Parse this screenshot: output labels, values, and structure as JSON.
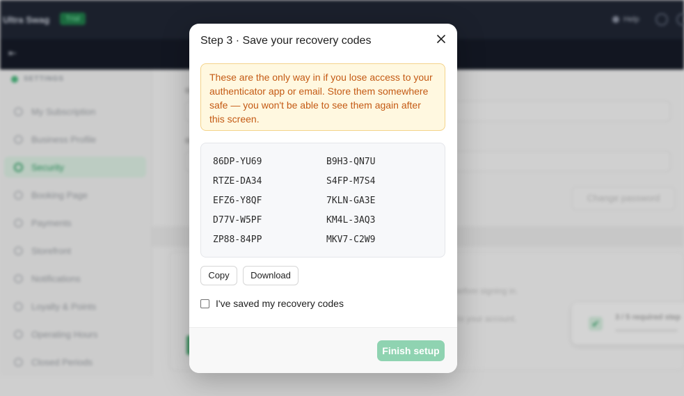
{
  "app": {
    "name": "Ultra Swag",
    "badge": "Trial",
    "help_label": "Help"
  },
  "sidebar": {
    "section_label": "SETTINGS",
    "items": [
      {
        "label": "My Subscription"
      },
      {
        "label": "Business Profile"
      },
      {
        "label": "Security",
        "active": true
      },
      {
        "label": "Booking Page"
      },
      {
        "label": "Payments"
      },
      {
        "label": "Storefront"
      },
      {
        "label": "Notifications"
      },
      {
        "label": "Loyalty & Points"
      },
      {
        "label": "Operating Hours"
      },
      {
        "label": "Closed Periods"
      }
    ]
  },
  "security_page": {
    "change_password_label": "Change password",
    "lower_text_1": "before signing in.",
    "lower_text_2": "to your account.",
    "progress_card_text": "3 / 5 required step"
  },
  "modal": {
    "title": "Step 3 · Save your recovery codes",
    "warning": "These are the only way in if you lose access to your authenticator app or email. Store them somewhere safe — you won't be able to see them again after this screen.",
    "codes": [
      "86DP-YU69",
      "B9H3-QN7U",
      "RTZE-DA34",
      "S4FP-M7S4",
      "EFZ6-Y8QF",
      "7KLN-GA3E",
      "D77V-W5PF",
      "KM4L-3AQ3",
      "ZP88-84PP",
      "MKV7-C2W9"
    ],
    "copy_label": "Copy",
    "download_label": "Download",
    "confirm_label": "I've saved my recovery codes",
    "confirm_checked": false,
    "finish_label": "Finish setup",
    "finish_enabled": false
  },
  "colors": {
    "accent": "#2e9c63",
    "finish_disabled": "#8fd3b1",
    "warning_bg": "#fff8e0",
    "warning_text": "#c45a14"
  }
}
